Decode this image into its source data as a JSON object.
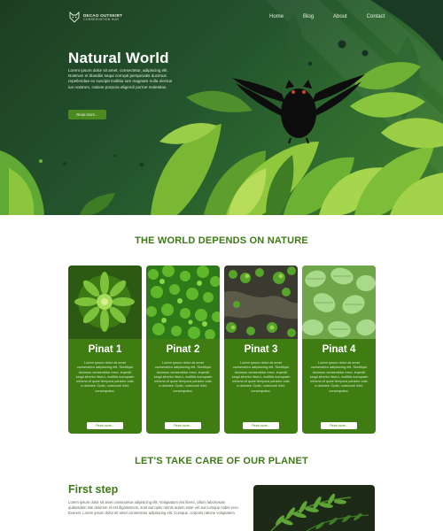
{
  "brand": {
    "logo_icon": "wolf-head-icon",
    "name": "DECAO OUTSKIRT",
    "tagline": "CONSERVATION HUB"
  },
  "nav": {
    "items": [
      "Home",
      "Blog",
      "About",
      "Contact"
    ]
  },
  "hero": {
    "title": "Natural World",
    "text": "Lorem ipsum dolor sit amet, consectetur, adipiscing elit. Nostrum et blandiis sequi corrupti perspiciatis ducimus repellendae ex suscipit mollitia iure magnam nulla olectus iue nostrum, ratione porpora eligendi porroe molestias.",
    "button": "Read more..."
  },
  "section1": {
    "title": "THE WORLD DEPENDS ON NATURE"
  },
  "cards": [
    {
      "title": "Pinat 1",
      "text": "Lorem ipsum dolor sit amet consectetur adipisicing elit. Similique ducimus consectetur error, impedit sequi tenetur libero, mollitia numquam minima et quae tempora pariatur odio a dolores! Optio, commodi nihil, consequatur.",
      "button": "Read more..."
    },
    {
      "title": "Pinat 2",
      "text": "Lorem ipsum dolor sit amet consectetur adipisicing elit. Similique ducimus consectetur error, impedit sequi tenetur libero, mollitia numquam minima et quae tempora pariatur odio a dolores! Optio, commodi nihil, consequatur.",
      "button": "Read more..."
    },
    {
      "title": "Pinat 3",
      "text": "Lorem ipsum dolor sit amet consectetur adipisicing elit. Similique ducimus consectetur error, impedit sequi tenetur libero, mollitia numquam minima et quae tempora pariatur odio a dolores! Optio, commodi nihil, consequatur.",
      "button": "Read more..."
    },
    {
      "title": "Pinat 4",
      "text": "Lorem ipsum dolor sit amet consectetur adipisicing elit. Similique ducimus consectetur error, impedit sequi tenetur libero, mollitia numquam minima et quae tempora pariatur odio a dolores! Optio, commodi nihil, consequatur.",
      "button": "Read more..."
    }
  ],
  "section2": {
    "title": "LET'S TAKE CARE OF OUR PLANET"
  },
  "step": {
    "title": "First step",
    "text": "Lorem ipsum dolor sit amet consectetur adipisicing elit. Voluptatum nisi libero, cillum laboriosam quibusdam iste dolorem et est dignissimos, sunt aut optio omnis autem esse vel aut cumque nobis vero. Eveniet. Lorem ipsum dolor sit amet consectetur adipisicing elit. Cumque, corporis ratione voluptatem"
  },
  "colors": {
    "brand_green": "#3f7d12",
    "heading_green": "#3e7a16",
    "hero_dark": "#1d3d22"
  }
}
